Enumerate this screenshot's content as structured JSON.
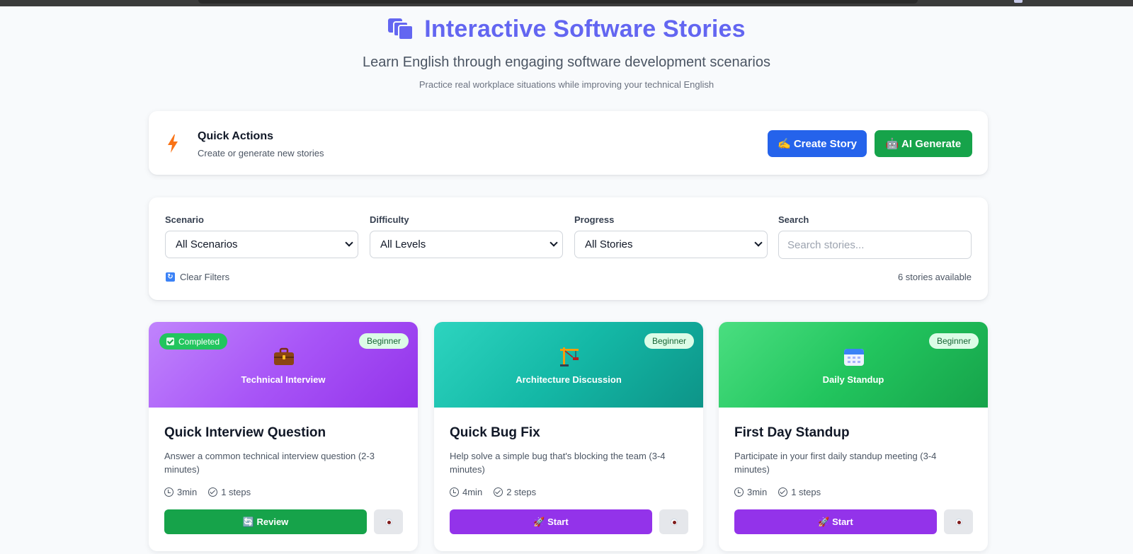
{
  "hero": {
    "icon": "folders-icon",
    "title": "Interactive Software Stories",
    "subtitle": "Learn English through engaging software development scenarios",
    "note": "Practice real workplace situations while improving your technical English"
  },
  "quick_actions": {
    "icon": "lightning-icon",
    "title": "Quick Actions",
    "subtitle": "Create or generate new stories",
    "create_label": "✍️ Create Story",
    "ai_label": "🤖 AI Generate"
  },
  "filters": {
    "scenario_label": "Scenario",
    "scenario_value": "All Scenarios",
    "difficulty_label": "Difficulty",
    "difficulty_value": "All Levels",
    "progress_label": "Progress",
    "progress_value": "All Stories",
    "search_label": "Search",
    "search_placeholder": "Search stories...",
    "clear_label": "Clear Filters",
    "count_text": "6 stories available"
  },
  "cards": [
    {
      "scenario": "Technical Interview",
      "scenario_icon": "briefcase-icon",
      "level": "Beginner",
      "status": "Completed",
      "title": "Quick Interview Question",
      "description": "Answer a common technical interview question (2-3 minutes)",
      "duration": "3min",
      "steps": "1 steps",
      "action": "🔄 Review",
      "colors": {
        "from": "#c084fc",
        "to": "#9333ea"
      }
    },
    {
      "scenario": "Architecture Discussion",
      "scenario_icon": "crane-icon",
      "level": "Beginner",
      "title": "Quick Bug Fix",
      "description": "Help solve a simple bug that's blocking the team (3-4 minutes)",
      "duration": "4min",
      "steps": "2 steps",
      "action": "🚀 Start",
      "colors": {
        "from": "#2dd4bf",
        "to": "#0d9488"
      }
    },
    {
      "scenario": "Daily Standup",
      "scenario_icon": "calendar-icon",
      "level": "Beginner",
      "title": "First Day Standup",
      "description": "Participate in your first daily standup meeting (3-4 minutes)",
      "duration": "3min",
      "steps": "1 steps",
      "action": "🚀 Start",
      "colors": {
        "from": "#4ade80",
        "to": "#16a34a"
      }
    }
  ],
  "colors": {
    "accent": "#6366f1",
    "create_button": "#2563eb",
    "ai_button": "#16a34a",
    "review_button": "#16a34a",
    "start_button": "#9333ea"
  }
}
